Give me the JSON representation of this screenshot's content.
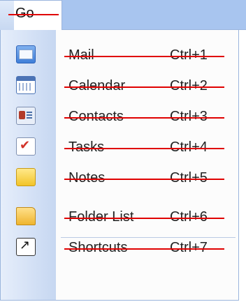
{
  "menubar": {
    "go_label": "Go"
  },
  "menu": {
    "items": [
      {
        "label": "Mail",
        "shortcut": "Ctrl+1",
        "icon": "mail-icon"
      },
      {
        "label": "Calendar",
        "shortcut": "Ctrl+2",
        "icon": "calendar-icon"
      },
      {
        "label": "Contacts",
        "shortcut": "Ctrl+3",
        "icon": "contacts-icon"
      },
      {
        "label": "Tasks",
        "shortcut": "Ctrl+4",
        "icon": "tasks-icon"
      },
      {
        "label": "Notes",
        "shortcut": "Ctrl+5",
        "icon": "notes-icon"
      },
      {
        "label": "Folder List",
        "shortcut": "Ctrl+6",
        "icon": "folder-icon"
      },
      {
        "label": "Shortcuts",
        "shortcut": "Ctrl+7",
        "icon": "shortcuts-icon"
      }
    ]
  },
  "colors": {
    "strike": "#e00000",
    "menubar": "#a8c5ef",
    "gutter": "#c6d7f1"
  }
}
